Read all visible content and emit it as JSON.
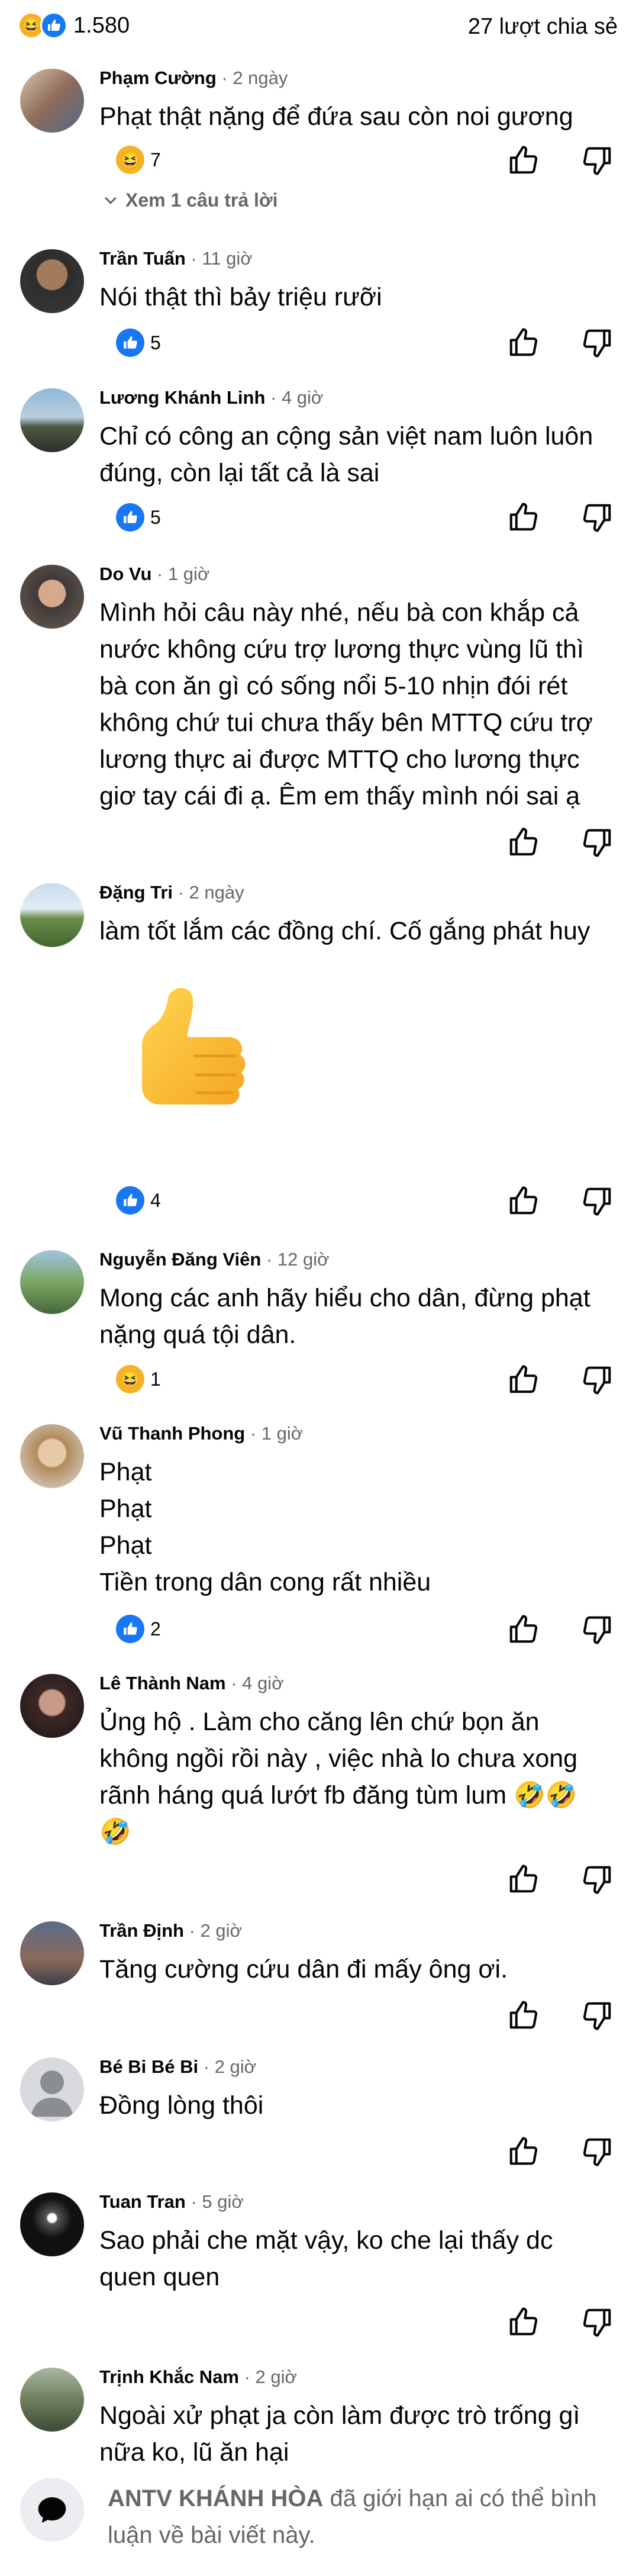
{
  "top": {
    "reaction_count": "1.580",
    "shares": "27 lượt chia sẻ",
    "icons": [
      "haha-icon",
      "like-icon"
    ]
  },
  "comments": [
    {
      "name": "Phạm Cường",
      "time": " · 2 ngày",
      "text": "Phạt thật nặng để đứa sau còn noi gương",
      "react": "haha",
      "count": "7",
      "replies": "Xem 1 câu trả lời"
    },
    {
      "name": "Trần Tuấn",
      "time": " · 11 giờ",
      "text": "Nói thật thì bảy triệu rưỡi",
      "react": "like",
      "count": "5"
    },
    {
      "name": "Lương Khánh Linh",
      "time": " · 4 giờ",
      "text": "Chỉ có công an cộng sản việt nam luôn luôn\nđúng, còn lại tất cả là sai",
      "react": "like",
      "count": "5"
    },
    {
      "name": "Do Vu",
      "time": " · 1 giờ",
      "text": "Mình hỏi câu này nhé, nếu bà con khắp cả\nnước không cứu trợ lương thực vùng lũ thì\nbà con ăn gì có sống nổi 5-10 nhịn đói rét\nkhông chứ tui chưa thấy bên MTTQ cứu trợ\nlương thực ai được MTTQ  cho lương thực\ngiơ tay cái đi ạ. Êm em thấy mình nói sai ạ"
    },
    {
      "name": "Đặng Tri",
      "time": " · 2 ngày",
      "text": "làm tốt lắm các đồng chí. Cố gắng phát huy",
      "react": "like",
      "count": "4"
    },
    {
      "name": "Nguyễn Đăng Viên",
      "time": " · 12 giờ",
      "text": "Mong các anh hãy hiểu cho dân, đừng phạt\nnặng quá tội dân.",
      "react": "haha",
      "count": "1"
    },
    {
      "name": "Vũ Thanh Phong",
      "time": " · 1 giờ",
      "text": "Phạt\nPhạt\nPhạt\nTiền trong dân cong rất nhiều",
      "react": "like",
      "count": "2"
    },
    {
      "name": "Lê Thành Nam",
      "time": " · 4 giờ",
      "text": "Ủng hộ . Làm cho căng lên chứ bọn ăn\nkhông ngồi rồi này , việc nhà lo chưa xong\nrãnh háng quá lướt fb đăng tùm lum 🤣🤣\n🤣"
    },
    {
      "name": "Trần Định",
      "time": " · 2 giờ",
      "text": "Tăng cường cứu dân đi mấy ông ơi."
    },
    {
      "name": "Bé Bi Bé Bi",
      "time": " · 2 giờ",
      "text": "Đồng lòng thôi"
    },
    {
      "name": "Tuan Tran",
      "time": " · 5 giờ",
      "text": "Sao phải che mặt vậy, ko che lại thấy dc\nquen quen"
    },
    {
      "name": "Trịnh Khắc Nam",
      "time": " · 2 giờ",
      "text": "Ngoài xử phạt ja còn làm được trò trống gì\nnữa ko, lũ ăn hại"
    }
  ],
  "restriction": {
    "page": "ANTV KHÁNH HÒA",
    "text": " đã giới hạn ai có thể bình luận về bài viết này."
  },
  "colors": {
    "like": "#1877f2",
    "haha": "#f7b125",
    "meta": "#65676b"
  }
}
